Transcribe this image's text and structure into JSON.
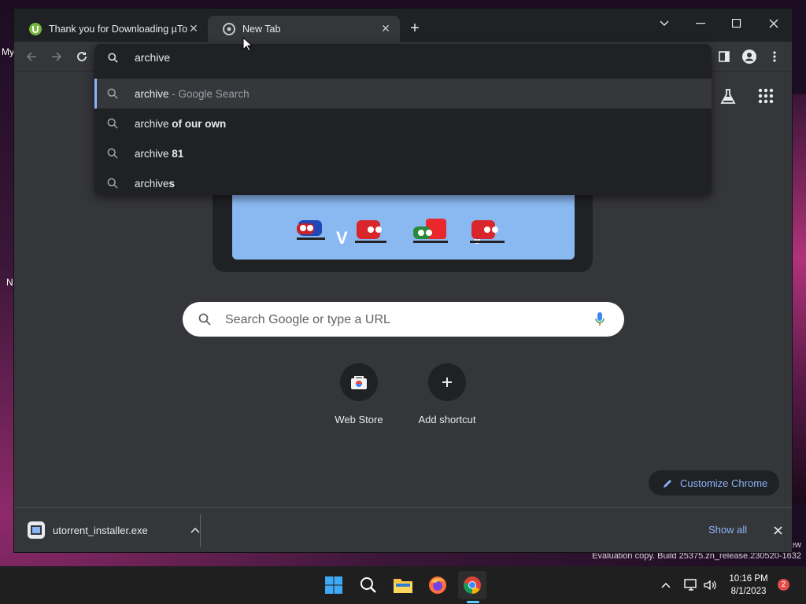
{
  "desktop": {
    "left_labels": [
      "My",
      "N"
    ],
    "watermark_tail": "ew",
    "watermark": "Evaluation copy. Build 25375.zn_release.230520-1632"
  },
  "browser": {
    "tabs": [
      {
        "title": "Thank you for Downloading µTorrent",
        "icon": "utorrent-icon",
        "active": false
      },
      {
        "title": "New Tab",
        "icon": "chrome-icon",
        "active": true
      }
    ],
    "omnibox": {
      "value": "archive",
      "suggestions": [
        {
          "prefix": "archive",
          "bold": "",
          "sub": " - Google Search",
          "selected": true
        },
        {
          "prefix": "archive",
          "bold": " of our own",
          "sub": "",
          "selected": false
        },
        {
          "prefix": "archive",
          "bold": " 81",
          "sub": "",
          "selected": false
        },
        {
          "prefix": "archive",
          "bold": "s",
          "sub": "",
          "selected": false
        }
      ]
    },
    "ntp": {
      "search_placeholder": "Search Google or type a URL",
      "shortcuts": [
        {
          "label": "Web Store",
          "icon": "web-store-icon"
        },
        {
          "label": "Add shortcut",
          "icon": "plus-icon"
        }
      ],
      "customize_label": "Customize Chrome",
      "doodle_letters": [
        "V",
        "V"
      ]
    },
    "download": {
      "filename": "utorrent_installer.exe",
      "show_all": "Show all"
    },
    "colors": {
      "accent": "#8ab4f8",
      "frame": "#202124",
      "toolbar": "#35363a"
    }
  },
  "taskbar": {
    "apps": [
      "windows-start-icon",
      "search-icon",
      "file-explorer-icon",
      "firefox-icon",
      "chrome-icon"
    ],
    "active_app": "chrome-icon",
    "time": "10:16 PM",
    "date": "8/1/2023",
    "notifications": "2"
  }
}
